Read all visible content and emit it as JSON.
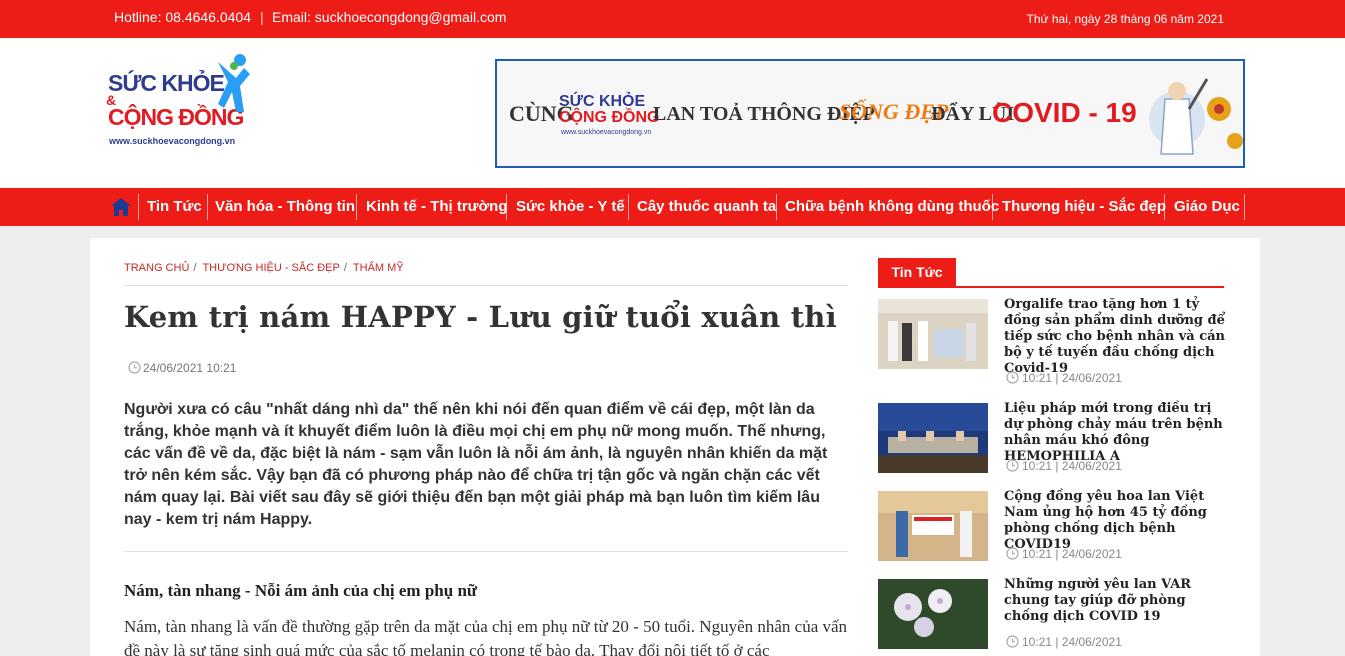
{
  "topbar": {
    "hotline": "Hotline: 08.4646.0404",
    "separator": "|",
    "email": "Email: suckhoecongdong@gmail.com",
    "date": "Thứ hai, ngày 28 tháng 06 năm 2021"
  },
  "logo": {
    "line1": "SỨC KHỎE",
    "amp": "&",
    "line2": "CỘNG ĐỒNG",
    "url": "www.suckhoevacongdong.vn"
  },
  "banner": {
    "word1": "CÙNG",
    "logo1": "SỨC KHỎE",
    "logo2": "CỘNG ĐỒNG",
    "logo3": "www.suckhoevacongdong.vn",
    "word2": "LAN TOẢ THÔNG ĐIỆP",
    "word3": "SỐNG ĐẸP",
    "word4": "ĐẨY LÙI",
    "word5": "COVID - 19"
  },
  "nav": {
    "home_icon": "home-icon",
    "items": [
      "Tin Tức",
      "Văn hóa - Thông tin",
      "Kinh tế - Thị trường",
      "Sức khỏe - Y tế",
      "Cây thuốc quanh ta",
      "Chữa bệnh không dùng thuốc",
      "Thương hiệu - Sắc đẹp",
      "Giáo Dục"
    ]
  },
  "breadcrumb": {
    "items": [
      "TRANG CHỦ",
      "THƯƠNG HIỆU - SẮC ĐẸP",
      "THẨM MỸ"
    ],
    "separator": "/"
  },
  "article": {
    "title": "Kem trị nám HAPPY - Lưu giữ tuổi xuân thì",
    "datetime": "24/06/2021 10:21",
    "lead": "Người xưa có câu \"nhất dáng nhì da\" thế nên khi nói đến quan điểm về cái đẹp, một làn da trắng, khỏe mạnh và ít khuyết điểm luôn là điều mọi chị em phụ nữ mong muốn. Thế nhưng, các vấn đề về da, đặc biệt là nám - sạm vẫn luôn là nỗi ám ảnh, là nguyên nhân khiến da mặt trở nên kém sắc. Vậy bạn đã có phương pháp nào để chữa trị tận gốc và ngăn chặn các vết nám quay lại. Bài viết sau đây sẽ giới thiệu đến bạn một giải pháp mà bạn luôn tìm kiếm lâu nay - kem trị nám Happy.",
    "subheading": "Nám, tàn nhang - Nỗi ám ảnh của chị em phụ nữ",
    "body": "Nám, tàn nhang là vấn đề thường gặp trên da mặt của chị em phụ nữ từ 20 - 50 tuổi. Nguyên nhân của vấn đề này là sự tăng sinh quá mức của sắc tố melanin có trong tế bào da. Thay đổi nội tiết tố ở các"
  },
  "sidebar": {
    "tab": "Tin Tức",
    "news": [
      {
        "title": "Orgalife trao tặng hơn 1 tỷ đồng sản phẩm dinh dưỡng để tiếp sức cho bệnh nhân và cán bộ y tế tuyến đầu chống dịch Covid-19",
        "meta": "10:21 | 24/06/2021"
      },
      {
        "title": "Liệu pháp mới trong điều trị dự phòng chảy máu trên bệnh nhân máu khó đông HEMOPHILIA A",
        "meta": "10:21 | 24/06/2021"
      },
      {
        "title": "Cộng đồng yêu hoa lan Việt Nam ủng hộ hơn 45 tỷ đồng phòng chống dịch bệnh COVID19",
        "meta": "10:21 | 24/06/2021"
      },
      {
        "title": "Những người yêu lan VAR chung tay giúp đỡ phòng chống dịch COVID 19",
        "meta": "10:21 | 24/06/2021"
      }
    ]
  },
  "colors": {
    "brand_red": "#ed1c16",
    "logo_blue": "#2f3b8f",
    "text_dark": "#333333"
  }
}
